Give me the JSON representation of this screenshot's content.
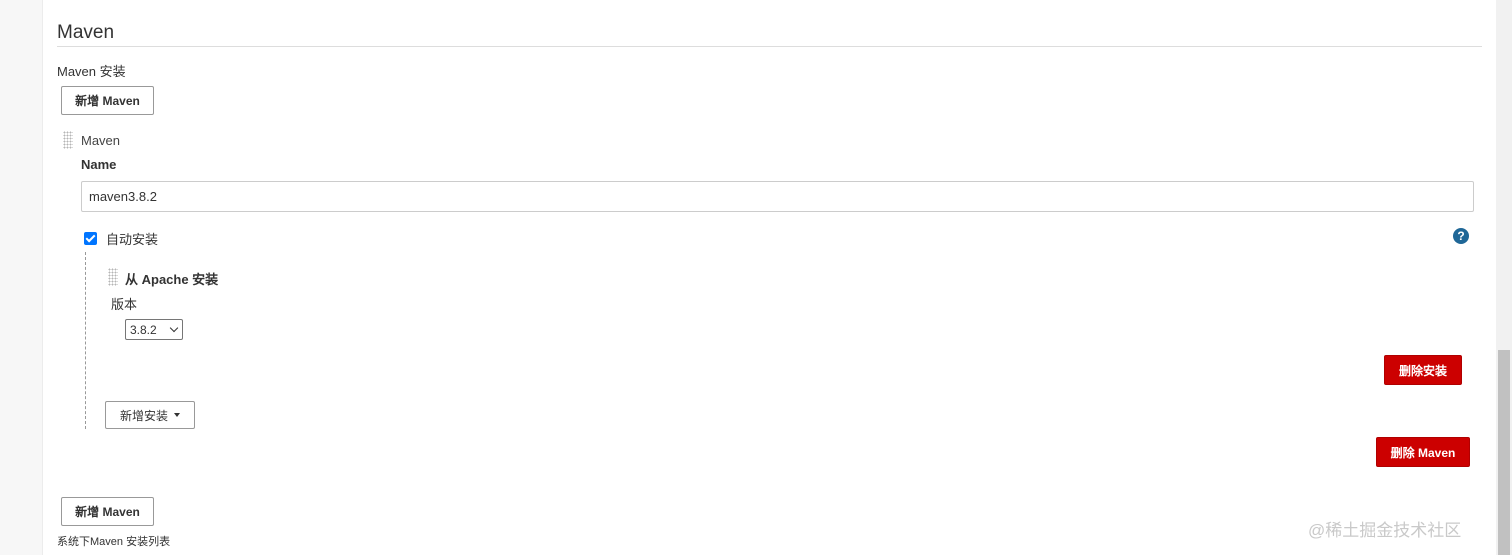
{
  "section": {
    "title": "Maven",
    "installations_label": "Maven 安装",
    "add_maven_label": "新增 Maven",
    "footnote": "系统下Maven 安装列表"
  },
  "installation": {
    "header": "Maven",
    "name_label": "Name",
    "name_value": "maven3.8.2",
    "auto_install_label": "自动安装",
    "auto_install_checked": true,
    "installer": {
      "title": "从 Apache 安装",
      "version_label": "版本",
      "version_selected": "3.8.2",
      "delete_installer_label": "删除安装"
    },
    "add_installer_label": "新增安装",
    "delete_maven_label": "删除 Maven"
  },
  "help_glyph": "?",
  "watermark": "@稀土掘金技术社区",
  "colors": {
    "danger": "#cc0000",
    "checkbox": "#0075ff",
    "help": "#1f6797"
  }
}
